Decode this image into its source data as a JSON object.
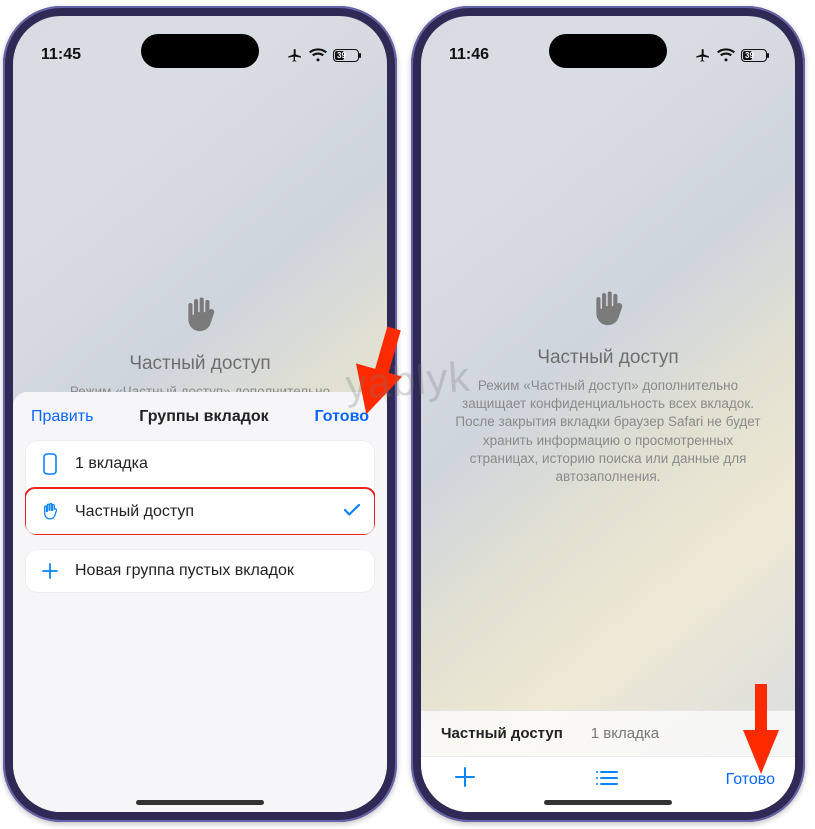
{
  "watermark": "yablyk",
  "left": {
    "status": {
      "time": "11:45",
      "battery": "39"
    },
    "private": {
      "title": "Частный доступ",
      "desc_truncated": "Режим «Частный доступ» дополнительно"
    },
    "sheet": {
      "edit": "Править",
      "title": "Группы вкладок",
      "done": "Готово",
      "items": [
        {
          "label": "1 вкладка",
          "icon": "tab-icon",
          "selected": false
        },
        {
          "label": "Частный доступ",
          "icon": "hand-icon",
          "selected": true
        }
      ],
      "new_group": "Новая группа пустых вкладок"
    }
  },
  "right": {
    "status": {
      "time": "11:46",
      "battery": "39"
    },
    "private": {
      "title": "Частный доступ",
      "desc": "Режим «Частный доступ» дополнительно защищает конфиденциальность всех вкладок. После закрытия вкладки браузер Safari не будет хранить информацию о просмотренных страницах, историю поиска или данные для автозаполнения."
    },
    "tabs": {
      "active": "Частный доступ",
      "other": "1 вкладка"
    },
    "toolbar": {
      "done": "Готово"
    }
  }
}
